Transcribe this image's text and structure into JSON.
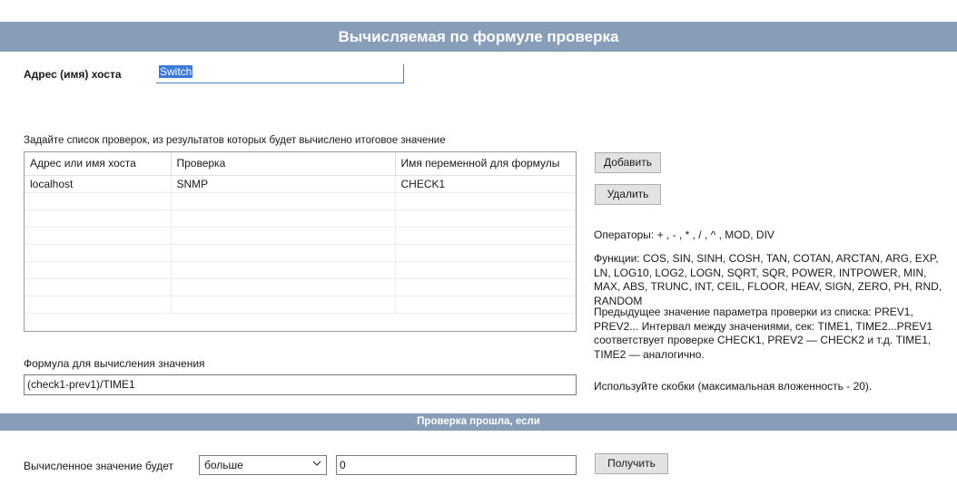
{
  "header": {
    "title": "Вычисляемая по формуле проверка"
  },
  "host": {
    "label": "Адрес (имя) хоста",
    "value": "Switch"
  },
  "checks": {
    "title": "Задайте список проверок, из результатов которых будет вычислено итоговое значение",
    "columns": [
      "Адрес или имя хоста",
      "Проверка",
      "Имя переменной для формулы"
    ],
    "rows": [
      [
        "localhost",
        "SNMP",
        "CHECK1"
      ],
      [
        "",
        "",
        ""
      ],
      [
        "",
        "",
        ""
      ],
      [
        "",
        "",
        ""
      ],
      [
        "",
        "",
        ""
      ],
      [
        "",
        "",
        ""
      ],
      [
        "",
        "",
        ""
      ],
      [
        "",
        "",
        ""
      ]
    ],
    "add_button": "Добавить",
    "delete_button": "Удалить"
  },
  "help": {
    "operators": "Операторы: + , - , * , / , ^ , MOD, DIV",
    "functions": "Функции: COS, SIN, SINH, COSH, TAN, COTAN, ARCTAN, ARG, EXP, LN, LOG10, LOG2, LOGN, SQRT, SQR, POWER, INTPOWER, MIN, MAX, ABS, TRUNC, INT, CEIL, FLOOR, HEAV, SIGN, ZERO, PH, RND, RANDOM",
    "previous": "Предыдущее значение параметра проверки из списка: PREV1, PREV2... Интервал между значениями, сек: TIME1, TIME2...PREV1 соответствует проверке CHECK1, PREV2 — CHECK2 и т.д. TIME1, TIME2 — аналогично.",
    "brackets": "Используйте скобки (максимальная вложенность - 20)."
  },
  "formula": {
    "label": "Формула для вычисления значения",
    "value": "(check1-prev1)/TIME1"
  },
  "condition": {
    "title": "Проверка прошла, если",
    "label": "Вычисленное значение будет",
    "operator": "больше",
    "value": "0",
    "get_button": "Получить"
  },
  "icons": {
    "dropdown": "chevron-down-icon"
  },
  "colors": {
    "header_bg": "#889db8",
    "selection": "#3c78d8"
  }
}
